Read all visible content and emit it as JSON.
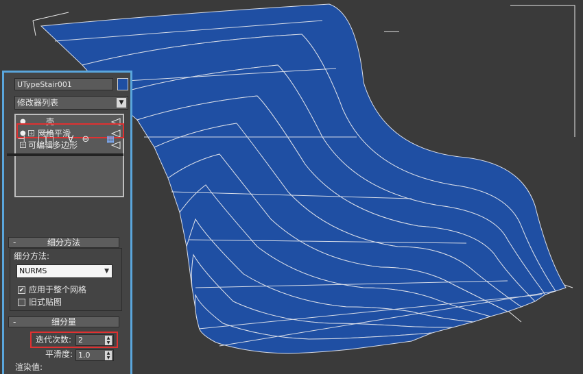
{
  "object_name": "UTypeStair001",
  "object_color": "#1f4fa3",
  "modifier_list": {
    "label": "修改器列表"
  },
  "stack": [
    {
      "label": "壳",
      "selected": false
    },
    {
      "label": "网格平滑",
      "selected": true
    },
    {
      "label": "可编辑多边形",
      "selected": false
    }
  ],
  "toolbar": {
    "pin_icon": "pin-stack-icon",
    "show_end_icon": "show-end-result-icon",
    "unique_icon": "make-unique-icon",
    "remove_icon": "remove-modifier-icon",
    "config_icon": "configure-sets-icon"
  },
  "subdivision_method": {
    "header": "细分方法",
    "minus": "-",
    "method_label": "细分方法:",
    "method_value": "NURMS",
    "apply_whole_mesh": {
      "label": "应用于整个网格",
      "checked": true
    },
    "old_mapping": {
      "label": "旧式贴图",
      "checked": false
    }
  },
  "subdivision_amount": {
    "header": "细分量",
    "minus": "-",
    "iterations_label": "迭代次数:",
    "iterations_value": "2",
    "smoothness_label": "平滑度:",
    "smoothness_value": "1.0",
    "render_values_label": "渲染值:"
  },
  "colors": {
    "viewport_bg": "#3a3a3a",
    "mesh_blue": "#1f4fa3",
    "highlight_red": "#e03131",
    "panel_border": "#5aa6dc"
  }
}
